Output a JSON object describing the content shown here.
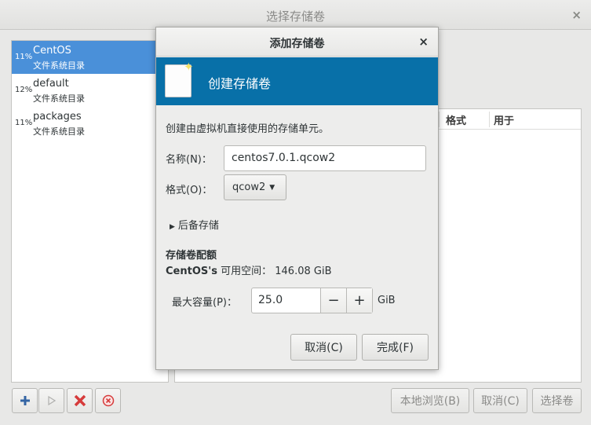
{
  "window": {
    "title": "选择存储卷",
    "close_glyph": "×"
  },
  "pools": [
    {
      "percent": "11%",
      "name": "CentOS",
      "type": "文件系统目录",
      "selected": true
    },
    {
      "percent": "12%",
      "name": "default",
      "type": "文件系统目录",
      "selected": false
    },
    {
      "percent": "11%",
      "name": "packages",
      "type": "文件系统目录",
      "selected": false
    }
  ],
  "volume_table": {
    "columns": [
      "格式",
      "用于"
    ]
  },
  "toolbar": {
    "add_icon": "plus-icon",
    "start_icon": "play-icon",
    "stop_icon": "x-icon",
    "delete_icon": "delete-circle-icon"
  },
  "bottom_buttons": {
    "browse_local": "本地浏览(B)",
    "cancel": "取消(C)",
    "choose_volume": "选择卷"
  },
  "dialog": {
    "title": "添加存储卷",
    "close_glyph": "×",
    "banner_title": "创建存储卷",
    "description": "创建由虚拟机直接使用的存储单元。",
    "name_label": "名称(N)：",
    "name_value": "centos7.0.1.qcow2",
    "format_label": "格式(O)：",
    "format_value": "qcow2",
    "backing_label": "后备存储",
    "quota_heading": "存储卷配额",
    "pool_name_bold": "CentOS's",
    "available_label": "可用空间：",
    "available_value": "146.08 GiB",
    "max_capacity_label": "最大容量(P)：",
    "max_capacity_value": "25.0",
    "capacity_unit": "GiB",
    "cancel_label": "取消(C)",
    "finish_label": "完成(F)"
  },
  "colors": {
    "selection": "#4a90d9",
    "banner": "#0870a8",
    "delete_red": "#d63b3b"
  }
}
